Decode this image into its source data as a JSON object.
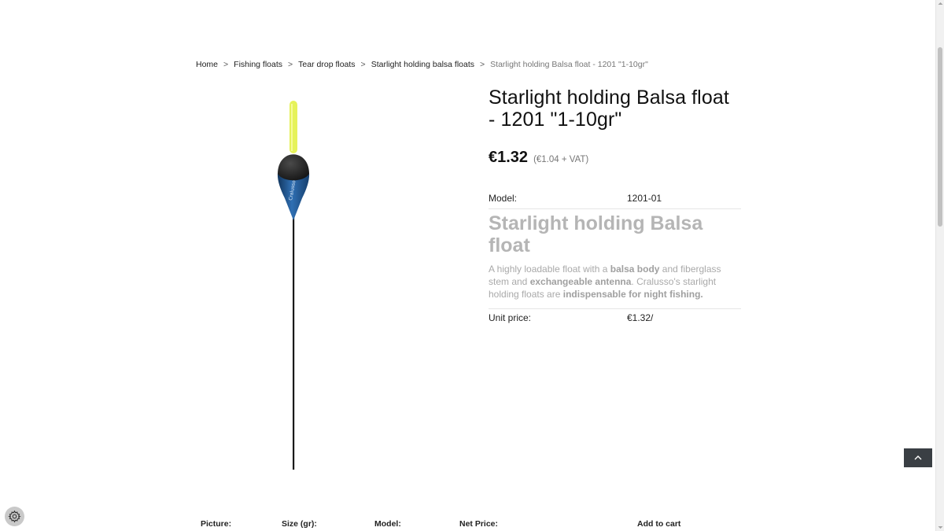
{
  "breadcrumb": {
    "items": [
      "Home",
      "Fishing floats",
      "Tear drop floats",
      "Starlight holding balsa floats"
    ],
    "current": "Starlight holding Balsa float - 1201 \"1-10gr\"",
    "separator": ">"
  },
  "product": {
    "title": "Starlight holding Balsa float - 1201 \"1-10gr\"",
    "price": "€1.32",
    "price_net": "(€1.04 + VAT)",
    "model_label": "Model:",
    "model_value": "1201-01",
    "desc_title": "Starlight holding Balsa float",
    "desc_parts": {
      "p1": "A highly loadable float with a ",
      "b1": "balsa body",
      "p2": " and fiberglass stem and ",
      "b2": "exchangeable antenna",
      "p3": ". Cralusso's starlight holding floats are ",
      "b3": "indispensable for night fishing."
    },
    "unit_price_label": "Unit price:",
    "unit_price_value": "€1.32/",
    "image_logo_text": "Cralusso",
    "colors": {
      "antenna": "#e6f25a",
      "body_top": "#2a2a2a",
      "body_bottom": "#1f5a99",
      "stem": "#1a1a1a"
    }
  },
  "table": {
    "headers": [
      "Picture:",
      "Size (gr):",
      "Model:",
      "Net Price:",
      "Add to cart"
    ]
  },
  "controls": {
    "back_to_top_icon": "chevron-up-icon",
    "settings_icon": "gear-icon"
  }
}
